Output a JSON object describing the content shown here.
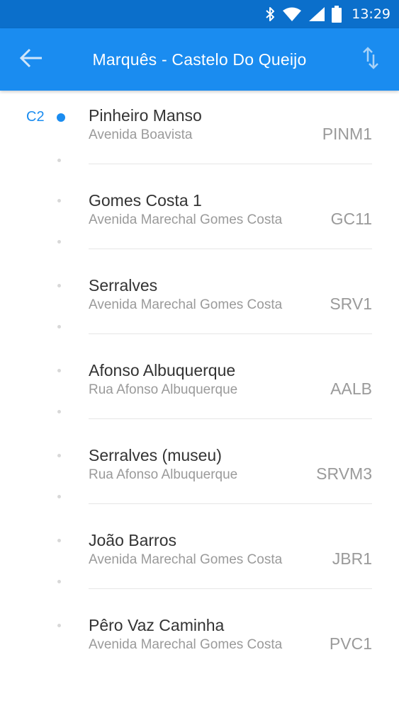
{
  "status_bar": {
    "time": "13:29",
    "icons": [
      "bluetooth-icon",
      "wifi-icon",
      "signal-icon",
      "battery-icon"
    ]
  },
  "app_bar": {
    "title": "Marquês - Castelo Do Queijo",
    "back_icon": "arrow-back-icon",
    "swap_icon": "swap-vertical-icon"
  },
  "colors": {
    "status_bar": "#0b6fcb",
    "app_bar": "#1a8cf0",
    "accent": "#1a8cf0"
  },
  "current_line": "C2",
  "stops": [
    {
      "name": "Pinheiro Manso",
      "street": "Avenida Boavista",
      "code": "PINM1"
    },
    {
      "name": "Gomes Costa 1",
      "street": "Avenida Marechal Gomes Costa",
      "code": "GC11"
    },
    {
      "name": "Serralves",
      "street": "Avenida Marechal Gomes Costa",
      "code": "SRV1"
    },
    {
      "name": "Afonso Albuquerque",
      "street": "Rua Afonso Albuquerque",
      "code": "AALB"
    },
    {
      "name": "Serralves (museu)",
      "street": "Rua Afonso Albuquerque",
      "code": "SRVM3"
    },
    {
      "name": "João Barros",
      "street": "Avenida Marechal Gomes Costa",
      "code": "JBR1"
    },
    {
      "name": "Pêro Vaz Caminha",
      "street": "Avenida Marechal Gomes Costa",
      "code": "PVC1"
    }
  ]
}
